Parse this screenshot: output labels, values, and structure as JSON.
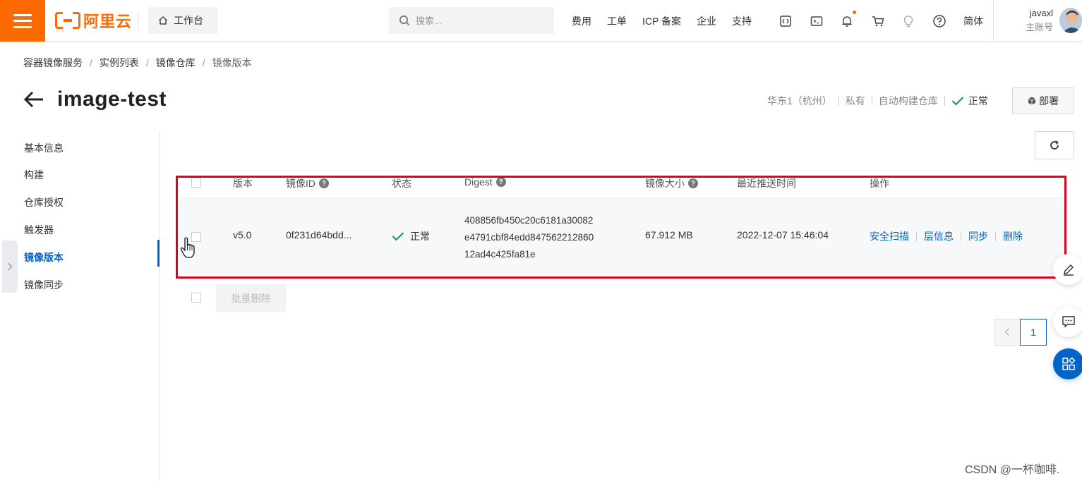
{
  "topbar": {
    "brand": "阿里云",
    "workbench_label": "工作台",
    "search_placeholder": "搜索...",
    "links": [
      "费用",
      "工单",
      "ICP 备案",
      "企业",
      "支持"
    ],
    "lang": "简体",
    "user_name": "javaxl",
    "user_role": "主账号",
    "accent_color": "#ff6a00"
  },
  "breadcrumb": [
    "容器镜像服务",
    "实例列表",
    "镜像仓库",
    "镜像版本"
  ],
  "repo": {
    "title": "image-test",
    "region": "华东1（杭州）",
    "visibility": "私有",
    "build_type": "自动构建仓库",
    "status": "正常",
    "deploy_label": "部署"
  },
  "sidebar": {
    "items": [
      "基本信息",
      "构建",
      "仓库授权",
      "触发器",
      "镜像版本",
      "镜像同步"
    ],
    "active": "镜像版本"
  },
  "table": {
    "headers": [
      "版本",
      "镜像ID",
      "状态",
      "Digest",
      "镜像大小",
      "最近推送时间",
      "操作"
    ],
    "rows": [
      {
        "version": "v5.0",
        "image_id": "0f231d64bdd...",
        "status": "正常",
        "digest_line1": "408856fb450c20c6181a30082",
        "digest_line2": "e4791cbf84edd847562212860",
        "digest_line3": "12ad4c425fa81e",
        "size": "67.912 MB",
        "pushed_at": "2022-12-07 15:46:04",
        "actions": [
          "安全扫描",
          "层信息",
          "同步",
          "删除"
        ]
      }
    ]
  },
  "batch_delete_label": "批量删除",
  "pagination": {
    "current": "1"
  },
  "watermark": "CSDN @一杯咖啡."
}
